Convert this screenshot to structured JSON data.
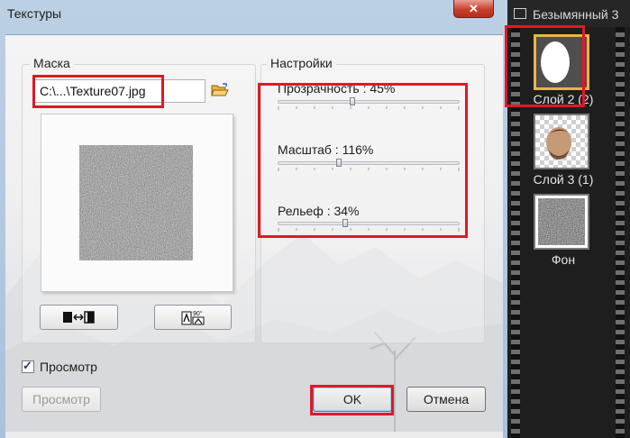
{
  "dialog": {
    "title": "Текстуры",
    "close_label": "✕",
    "mask": {
      "group_label": "Маска",
      "file_value": "C:\\...\\Texture07.jpg",
      "browse_icon": "folder-open-icon",
      "swap_icon": "swap-icon",
      "rotate_icon": "rotate-90-icon"
    },
    "settings": {
      "group_label": "Настройки",
      "sliders": [
        {
          "label": "Прозрачность : 45%",
          "value": 45
        },
        {
          "label": "Масштаб : 116%",
          "value": 116
        },
        {
          "label": "Рельеф : 34%",
          "value": 34
        }
      ]
    },
    "preview_checkbox": {
      "label": "Просмотр",
      "checked": true
    },
    "preview_button": "Просмотр",
    "ok_button": "OK",
    "cancel_button": "Отмена"
  },
  "layers_panel": {
    "title": "Безымянный 3",
    "layers": [
      {
        "name": "Слой 2 (2)",
        "selected": true
      },
      {
        "name": "Слой 3 (1)",
        "selected": false
      },
      {
        "name": "Фон",
        "selected": false
      }
    ]
  },
  "colors": {
    "annotation": "#e01826",
    "selection": "#e7b54a"
  }
}
